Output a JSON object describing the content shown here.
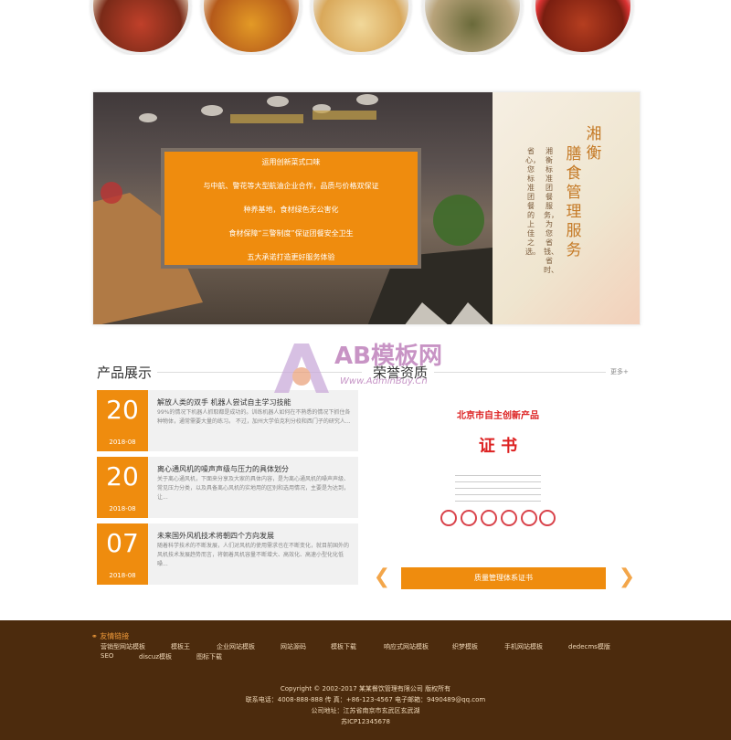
{
  "banner": {
    "box_lines": [
      "运用创新菜式口味",
      "与中航、警花等大型航油企业合作，品质与价格双保证",
      "种养基地，食材绿色无公害化",
      "食材保障“三警制度”保证团餐安全卫生",
      "五大承诺打造更好服务体验"
    ],
    "vertical_title_1": "湘衡",
    "vertical_title_2": "膳食管理服务",
    "vertical_lines": [
      "湘衡标准团餐服务，为您省钱、省时、",
      "省心，您标准团餐的上佳之选。"
    ]
  },
  "products": {
    "title": "产品展示"
  },
  "honor": {
    "title": "荣誉资质",
    "more": "更多+",
    "button": "质量管理体系证书"
  },
  "certificate": {
    "title": "北京市自主创新产品",
    "subtitle": "证 书"
  },
  "news": [
    {
      "day": "20",
      "ym": "2018-08",
      "title": "解放人类的双手 机器人尝试自主学习技能",
      "desc": "99%的情况下机器人抓取都是成功的。训练机器人如何在不熟悉的情况下抓住各种物体，通常需要大量的练习。 不过，加州大学伯克利分校和西门子的研究人..."
    },
    {
      "day": "20",
      "ym": "2018-08",
      "title": "离心通风机的噪声声级与压力的具体划分",
      "desc": "关于离心通风机，下面来分享及大家的具体内容，是为离心通风机的噪声声级、常见压力分类，以及具备离心风机的实地用的区别和选用情况，主要是为达到，让..."
    },
    {
      "day": "07",
      "ym": "2018-08",
      "title": "未来国外风机技术将朝四个方向发展",
      "desc": "随着科学技术的不断发展，人们对风机的使用需求也在不断变化，就目前国外的风机技术发展趋势而言，将朝着风机容量不断增大、高效化、高速小型化化低噪..."
    }
  ],
  "watermark": {
    "logo": "AB模板网",
    "url": "Www.AdminBuy.Cn"
  },
  "footer": {
    "links_title": "友情链接",
    "links": [
      "营销型网站模板",
      "模板王",
      "企业网站模板",
      "网站源码",
      "模板下载",
      "响应式网站模板",
      "织梦模板",
      "手机网站模板",
      "dedecms模版",
      "SEO",
      "discuz模板",
      "图标下载"
    ],
    "copyright": "Copyright © 2002-2017 某某餐饮管理有限公司 版权所有",
    "contact": "联系电话：4008-888-888 传 真：+86-123-4567 电子邮箱：9490489@qq.com",
    "address": "公司地址：江苏省南京市玄武区玄武湖",
    "icp": "苏ICP12345678"
  },
  "colors": {
    "accent": "#ef8c0e",
    "footer_bg": "#4c2b0d"
  }
}
